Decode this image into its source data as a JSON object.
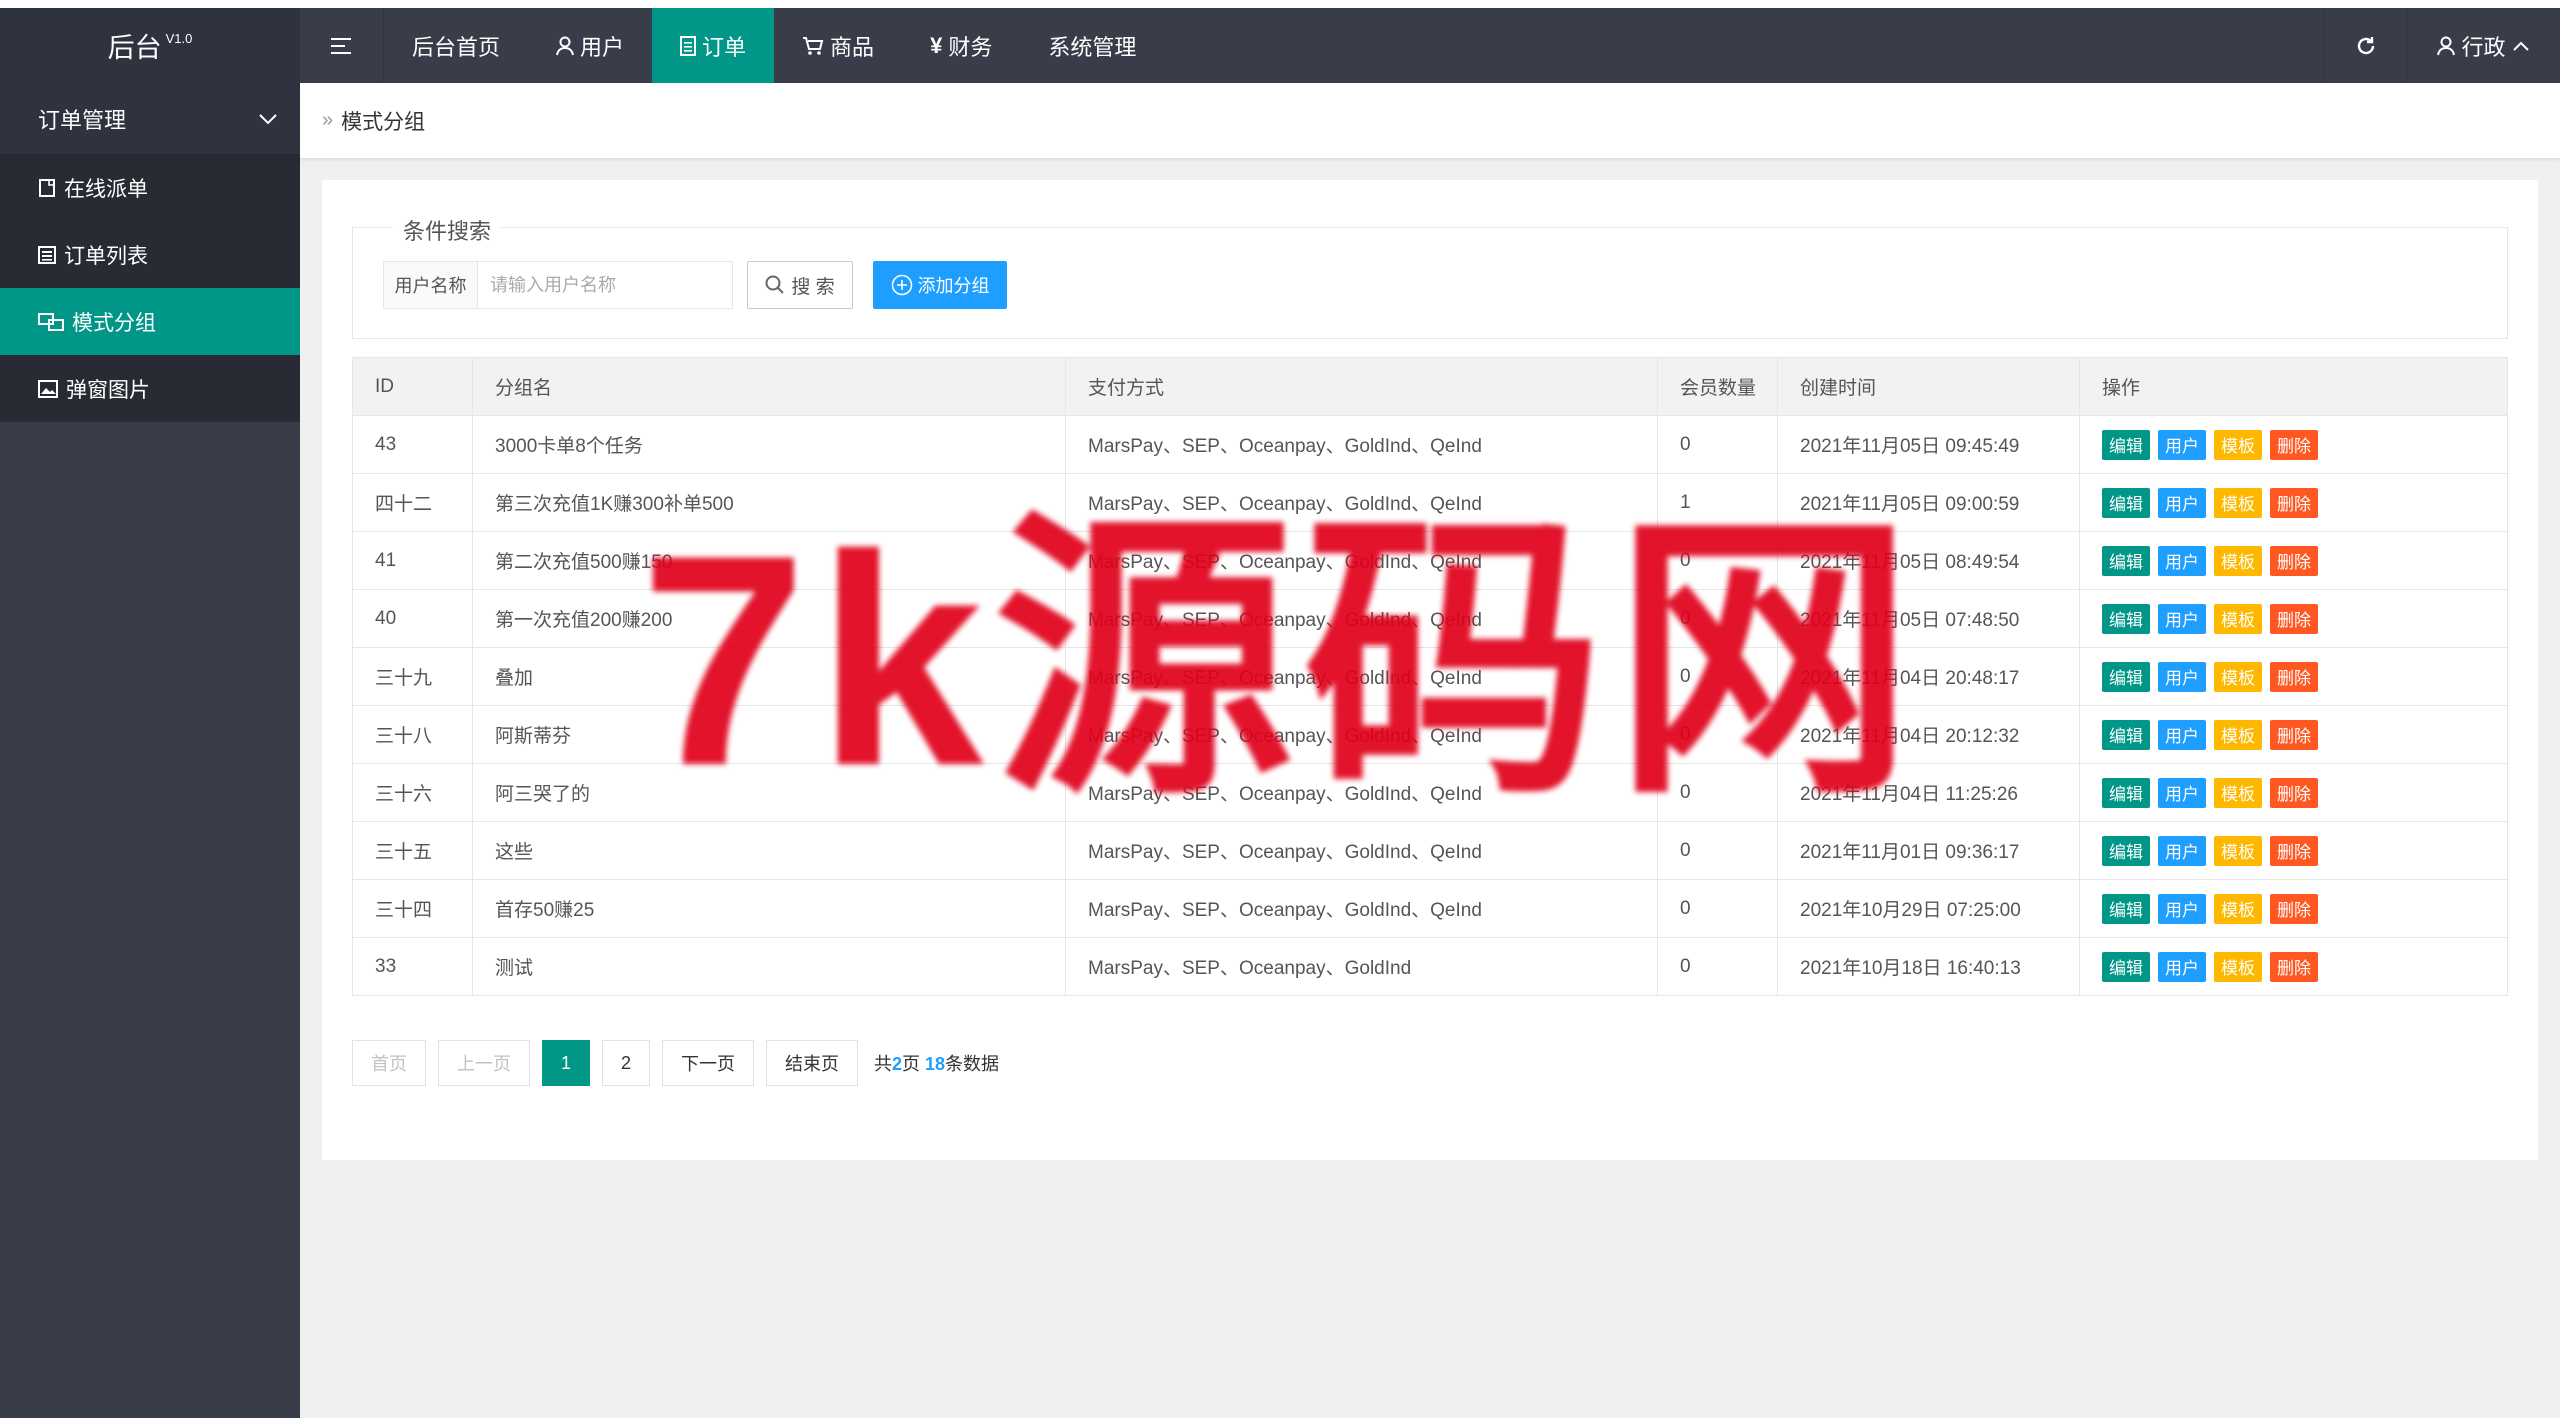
{
  "app": {
    "logo": "后台",
    "version": "V1.0"
  },
  "nav": [
    {
      "label": "后台首页",
      "icon": ""
    },
    {
      "label": "用户",
      "icon": "user-icon"
    },
    {
      "label": "订单",
      "icon": "document-icon",
      "active": true
    },
    {
      "label": "商品",
      "icon": "cart-icon"
    },
    {
      "label": "财务",
      "icon": "yen-icon"
    },
    {
      "label": "系统管理",
      "icon": ""
    }
  ],
  "header_right": {
    "user": "行政"
  },
  "sidebar": {
    "group": "订单管理",
    "items": [
      {
        "label": "在线派单",
        "icon": "note-icon"
      },
      {
        "label": "订单列表",
        "icon": "list-icon"
      },
      {
        "label": "模式分组",
        "icon": "group-icon",
        "active": true
      },
      {
        "label": "弹窗图片",
        "icon": "image-icon"
      }
    ]
  },
  "breadcrumb": {
    "current": "模式分组"
  },
  "search": {
    "legend": "条件搜索",
    "label": "用户名称",
    "placeholder": "请输入用户名称",
    "value": "",
    "search_btn": "搜 索",
    "add_btn": "添加分组"
  },
  "table": {
    "headers": [
      "ID",
      "分组名",
      "支付方式",
      "会员数量",
      "创建时间",
      "操作"
    ],
    "rows": [
      [
        "43",
        "3000卡单8个任务",
        "MarsPay、SEP、Oceanpay、GoldInd、QeInd",
        "0",
        "2021年11月05日 09:45:49"
      ],
      [
        "四十二",
        "第三次充值1K赚300补单500",
        "MarsPay、SEP、Oceanpay、GoldInd、QeInd",
        "1",
        "2021年11月05日 09:00:59"
      ],
      [
        "41",
        "第二次充值500赚150",
        "MarsPay、SEP、Oceanpay、GoldInd、QeInd",
        "0",
        "2021年11月05日 08:49:54"
      ],
      [
        "40",
        "第一次充值200赚200",
        "MarsPay、SEP、Oceanpay、GoldInd、QeInd",
        "0",
        "2021年11月05日 07:48:50"
      ],
      [
        "三十九",
        "叠加",
        "MarsPay、SEP、Oceanpay、GoldInd、QeInd",
        "0",
        "2021年11月04日 20:48:17"
      ],
      [
        "三十八",
        "阿斯蒂芬",
        "MarsPay、SEP、Oceanpay、GoldInd、QeInd",
        "0",
        "2021年11月04日 20:12:32"
      ],
      [
        "三十六",
        "阿三哭了的",
        "MarsPay、SEP、Oceanpay、GoldInd、QeInd",
        "0",
        "2021年11月04日 11:25:26"
      ],
      [
        "三十五",
        "这些",
        "MarsPay、SEP、Oceanpay、GoldInd、QeInd",
        "0",
        "2021年11月01日 09:36:17"
      ],
      [
        "三十四",
        "首存50赚25",
        "MarsPay、SEP、Oceanpay、GoldInd、QeInd",
        "0",
        "2021年10月29日 07:25:00"
      ],
      [
        "33",
        "测试",
        "MarsPay、SEP、Oceanpay、GoldInd",
        "0",
        "2021年10月18日 16:40:13"
      ]
    ],
    "actions": [
      "编辑",
      "用户",
      "模板",
      "删除"
    ]
  },
  "pagination": {
    "first": "首页",
    "prev": "上一页",
    "pages": [
      "1",
      "2"
    ],
    "current": "1",
    "next": "下一页",
    "last": "结束页",
    "total_prefix": "共",
    "total_pages": "2",
    "pages_suffix": "页",
    "total_records": "18",
    "records_suffix": "条数据"
  },
  "watermark": "7k源码网",
  "colors": {
    "header": "#393d49",
    "accent": "#009688",
    "blue": "#1e9fff",
    "yellow": "#ffb800",
    "red": "#ff5722",
    "watermark": "#e0001a"
  }
}
